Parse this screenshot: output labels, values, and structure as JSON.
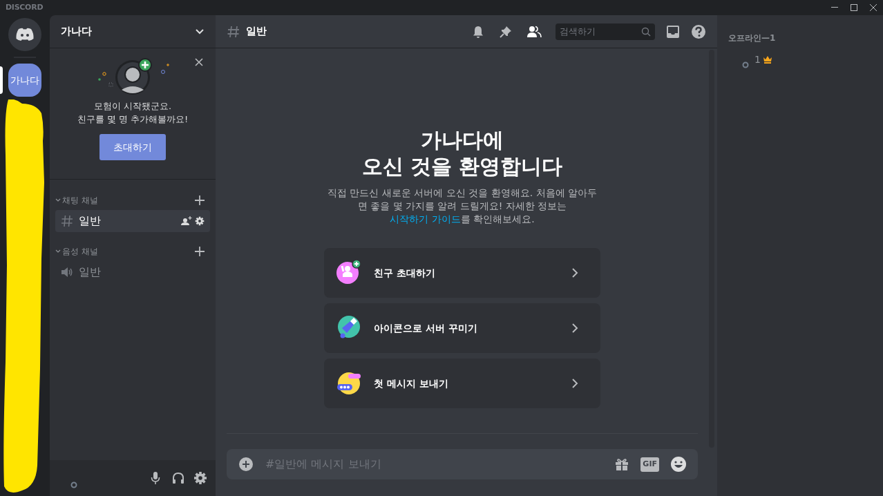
{
  "app": {
    "title": "DISCORD"
  },
  "servers": [
    {
      "label": "가나다",
      "selected": true
    }
  ],
  "server": {
    "name": "가나다"
  },
  "invite_card": {
    "lines": [
      "모험이 시작됐군요.",
      "친구를 몇 명 추가해볼까요!"
    ],
    "button": "초대하기"
  },
  "categories": [
    {
      "name": "채팅 채널",
      "kind": "text",
      "channels": [
        {
          "name": "일반",
          "selected": true
        }
      ]
    },
    {
      "name": "음성 채널",
      "kind": "voice",
      "channels": [
        {
          "name": "일반",
          "selected": false
        }
      ]
    }
  ],
  "header": {
    "channel": "일반",
    "search": {
      "placeholder": "검색하기"
    }
  },
  "welcome": {
    "title_lines": [
      "가나다에",
      "오신 것을 환영합니다"
    ],
    "description": "직접 만드신 새로운 서버에 오신 것을 환영해요. 처음에 알아두면 좋을 몇 가지를 알려 드릴게요! 자세한 정보는 ",
    "link": "시작하기 가이드",
    "description_end": "를 확인해보세요."
  },
  "actions": [
    {
      "kind": "invite",
      "label": "친구 초대하기"
    },
    {
      "kind": "icon",
      "label": "아이콘으로 서버 꾸미기"
    },
    {
      "kind": "message",
      "label": "첫 메시지 보내기"
    }
  ],
  "composer": {
    "placeholder": "#일반에 메시지 보내기",
    "gif": "GIF"
  },
  "members": {
    "group": "오프라인—1",
    "list": [
      {
        "name": "1",
        "owner": true
      }
    ]
  }
}
